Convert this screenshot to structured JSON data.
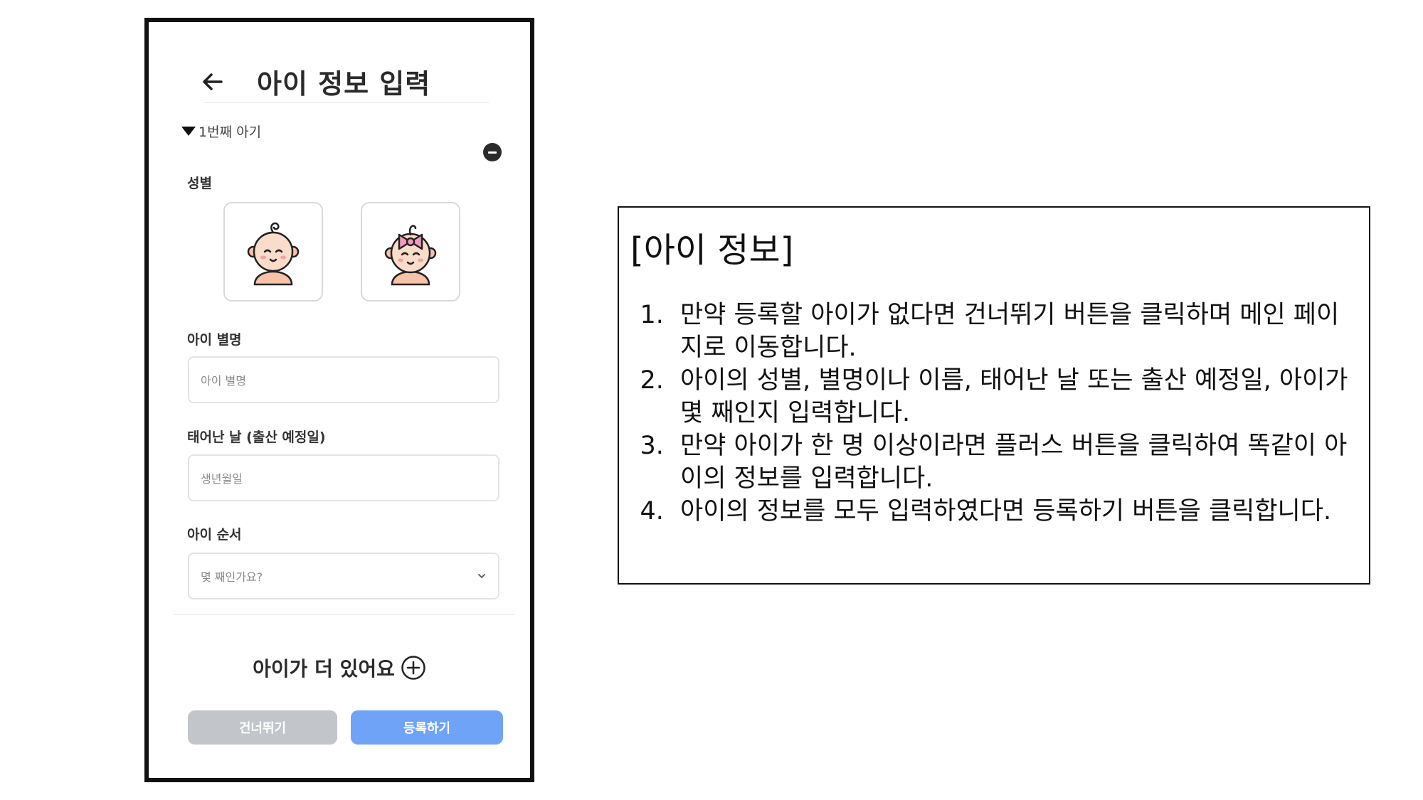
{
  "app": {
    "title": "아이 정보 입력",
    "section_toggle": "1번째 아기"
  },
  "form": {
    "gender_label": "성별",
    "gender_options": [
      "boy",
      "girl"
    ],
    "nickname_label": "아이 별명",
    "nickname_placeholder": "아이 별명",
    "birth_label": "태어난 날 (출산 예정일)",
    "birth_placeholder": "생년월일",
    "order_label": "아이 순서",
    "order_placeholder": "몇 째인가요?",
    "more_label": "아이가 더 있어요",
    "skip_button": "건너뛰기",
    "register_button": "등록하기"
  },
  "icons": {
    "back": "arrow-left-icon",
    "remove": "minus-circle-icon",
    "chevron": "chevron-down-icon",
    "plus": "plus-circle-icon"
  },
  "colors": {
    "register": "#6ea3f7",
    "skip": "#c2c5c9",
    "girl_bow": "#f29bc0"
  },
  "info": {
    "title": "[아이 정보]",
    "items": [
      "만약 등록할 아이가 없다면 건너뛰기 버튼을 클릭하며 메인 페이지로 이동합니다.",
      "아이의 성별, 별명이나 이름, 태어난 날 또는 출산 예정일, 아이가 몇 째인지 입력합니다.",
      "만약 아이가 한 명 이상이라면 플러스 버튼을 클릭하여 똑같이 아이의 정보를 입력합니다.",
      "아이의 정보를 모두 입력하였다면 등록하기 버튼을 클릭합니다."
    ]
  }
}
